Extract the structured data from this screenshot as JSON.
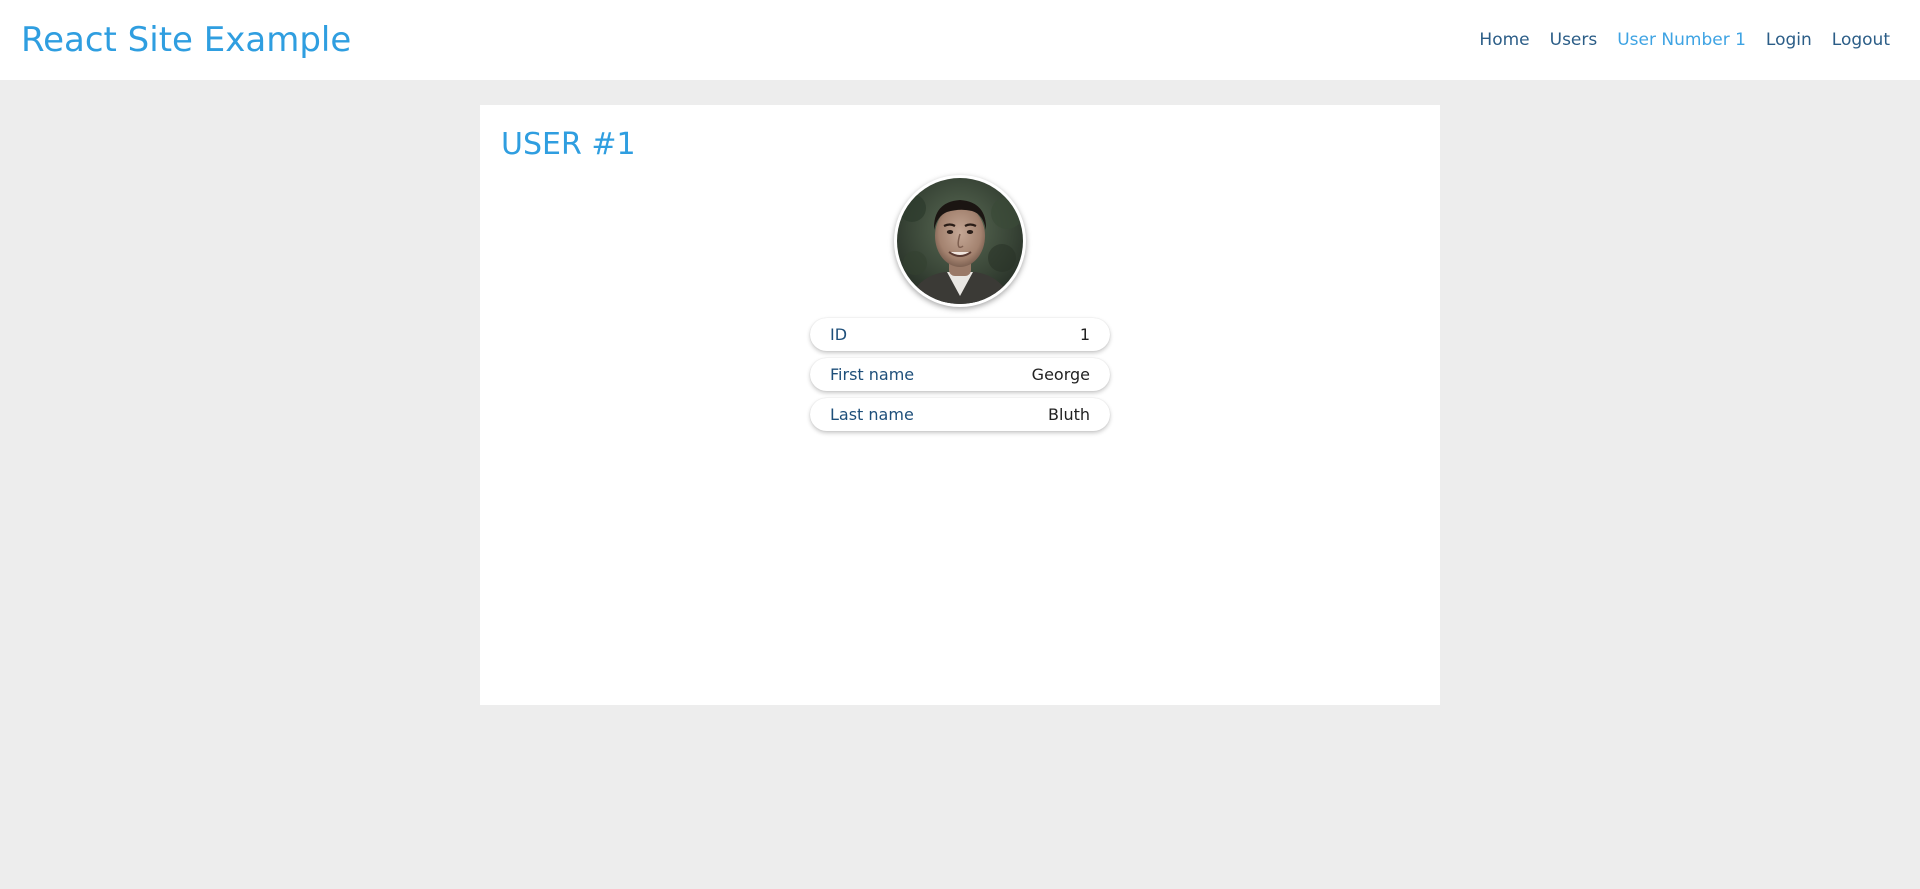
{
  "header": {
    "brand": "React Site Example",
    "nav": [
      {
        "label": "Home",
        "active": false
      },
      {
        "label": "Users",
        "active": false
      },
      {
        "label": "User Number 1",
        "active": true
      },
      {
        "label": "Login",
        "active": false
      },
      {
        "label": "Logout",
        "active": false
      }
    ]
  },
  "main": {
    "title": "USER #1",
    "avatar_icon": "user-avatar-photo",
    "fields": [
      {
        "label": "ID",
        "value": "1"
      },
      {
        "label": "First name",
        "value": "George"
      },
      {
        "label": "Last name",
        "value": "Bluth"
      }
    ]
  },
  "colors": {
    "accent": "#2f9ee0",
    "nav_text": "#2b5d87",
    "background": "#ededed"
  }
}
